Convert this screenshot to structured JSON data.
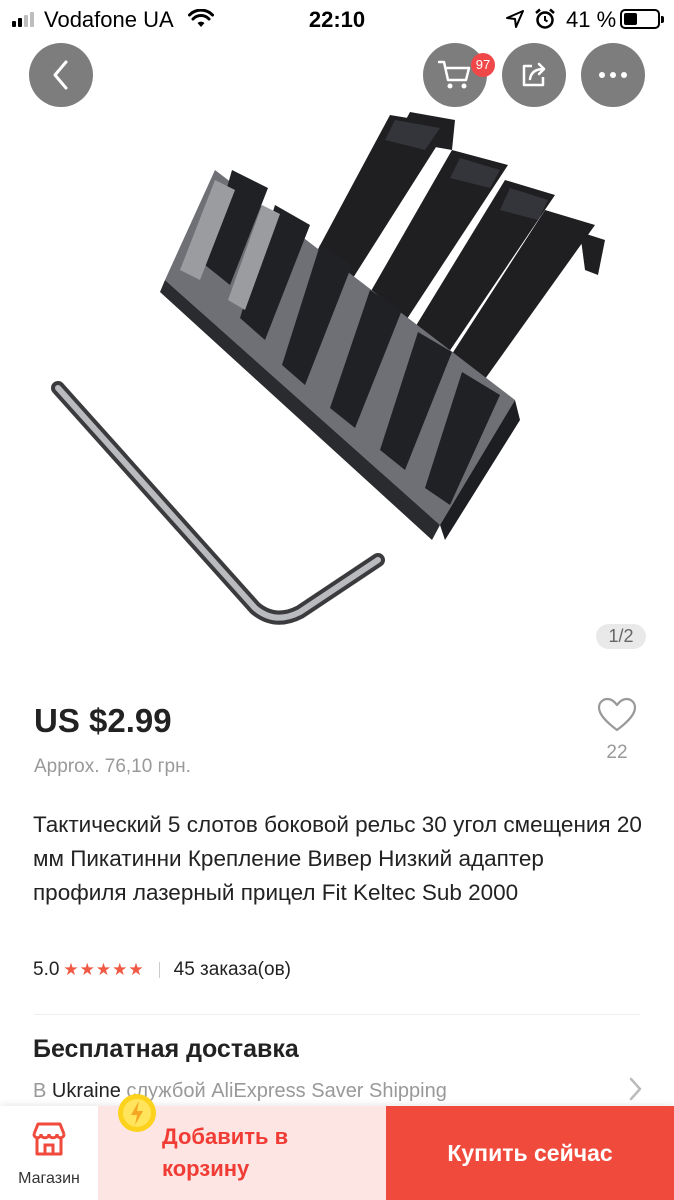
{
  "status_bar": {
    "carrier": "Vodafone UA",
    "time": "22:10",
    "battery_percent": "41 %",
    "battery_level": 0.41,
    "signal_bars": 4,
    "signal_active": 2
  },
  "header": {
    "cart_badge": "97",
    "back_icon": "chevron-left-icon",
    "cart_icon": "cart-icon",
    "share_icon": "share-icon",
    "more_icon": "ellipsis-icon"
  },
  "gallery": {
    "counter": "1/2"
  },
  "product": {
    "price": "US $2.99",
    "approx": "Approx. 76,10 грн.",
    "wishlist_count": "22",
    "title": "Тактический 5 слотов боковой рельс 30 угол смещения 20 мм Пикатинни Крепление Вивер Низкий адаптер профиля лазерный прицел Fit Keltec Sub 2000",
    "rating": "5.0",
    "stars": "★★★★★",
    "star_count": 5,
    "orders": "45 заказа(ов)"
  },
  "shipping": {
    "title": "Бесплатная доставка",
    "prefix": "В",
    "country": "Ukraine",
    "service": "службой AliExpress Saver Shipping"
  },
  "bottom_bar": {
    "store_label": "Магазин",
    "add_to_cart": "Добавить в корзину",
    "buy_now": "Купить сейчас"
  },
  "colors": {
    "accent": "#f04a3d",
    "add_cart_bg": "#fce5e3",
    "star": "#f05a45",
    "header_button": "#7d7d7d"
  }
}
